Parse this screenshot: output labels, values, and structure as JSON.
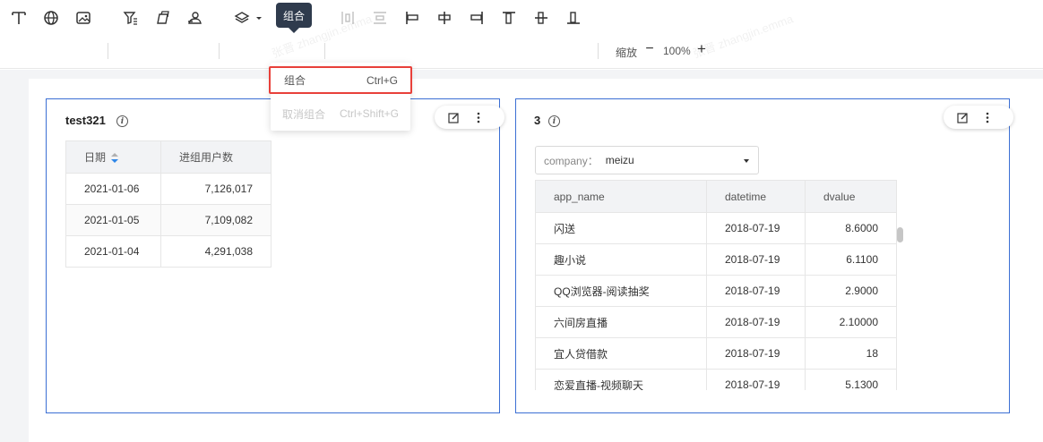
{
  "tooltip": {
    "text": "组合"
  },
  "toolbar": {
    "zoom_label": "缩放",
    "zoom_minus": "−",
    "zoom_value": "100%",
    "zoom_plus": "+"
  },
  "dropdown": {
    "items": [
      {
        "label": "组合",
        "shortcut": "Ctrl+G",
        "state": "highlighted"
      },
      {
        "label": "取消组合",
        "shortcut": "Ctrl+Shift+G",
        "state": "disabled"
      }
    ]
  },
  "card1": {
    "title": "test321",
    "info_icon": "i",
    "table": {
      "columns": [
        "日期",
        "进组用户数"
      ],
      "rows": [
        [
          "2021-01-06",
          "7,126,017"
        ],
        [
          "2021-01-05",
          "7,109,082"
        ],
        [
          "2021-01-04",
          "4,291,038"
        ]
      ]
    }
  },
  "card2": {
    "title": "3",
    "info_icon": "i",
    "filter": {
      "label": "company：",
      "value": "meizu"
    },
    "table": {
      "columns": [
        "app_name",
        "datetime",
        "dvalue"
      ],
      "rows": [
        [
          "闪送",
          "2018-07-19",
          "8.6000"
        ],
        [
          "趣小说",
          "2018-07-19",
          "6.1100"
        ],
        [
          "QQ浏览器-阅读抽奖",
          "2018-07-19",
          "2.9000"
        ],
        [
          "六间房直播",
          "2018-07-19",
          "2.10000"
        ],
        [
          "宜人贷借款",
          "2018-07-19",
          "18"
        ],
        [
          "恋爱直播-视频聊天",
          "2018-07-19",
          "5.1300"
        ]
      ]
    }
  },
  "watermark": "张晋 zhangjin.emma",
  "colors": {
    "accent": "#3b6fd4",
    "highlight_border": "#e8403a",
    "tooltip_bg": "#2f3b4d"
  }
}
